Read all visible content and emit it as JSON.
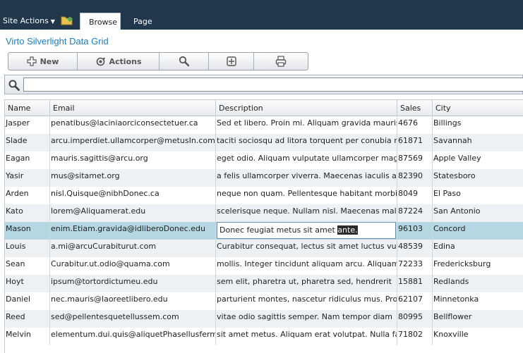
{
  "ribbon": {
    "site_actions": "Site Actions",
    "tabs": [
      {
        "label": "Browse"
      },
      {
        "label": "Page"
      }
    ]
  },
  "page": {
    "title": "Virto Silverlight Data Grid"
  },
  "toolbar": {
    "new_label": "New",
    "actions_label": "Actions"
  },
  "search": {
    "value": "",
    "placeholder": ""
  },
  "grid": {
    "columns": [
      "Name",
      "Email",
      "Description",
      "Sales",
      "City"
    ],
    "rows": [
      {
        "name": "Jasper",
        "email": "penatibus@laciniaorciconsectetuer.ca",
        "description": "Sed et libero. Proin mi. Aliquam gravida mauris",
        "sales": "4676",
        "city": "Billings"
      },
      {
        "name": "Slade",
        "email": "arcu.imperdiet.ullamcorper@metusIn.com",
        "description": "taciti sociosqu ad litora torquent per conubia n",
        "sales": "61871",
        "city": "Savannah"
      },
      {
        "name": "Eagan",
        "email": "mauris.sagittis@arcu.org",
        "description": "eget odio. Aliquam vulputate ullamcorper magna",
        "sales": "87569",
        "city": "Apple Valley"
      },
      {
        "name": "Yasir",
        "email": "mus@sitamet.org",
        "description": "a felis ullamcorper viverra. Maecenas iaculis a",
        "sales": "82390",
        "city": "Statesboro"
      },
      {
        "name": "Arden",
        "email": "nisl.Quisque@nibhDonec.ca",
        "description": "neque non quam. Pellentesque habitant morbi",
        "sales": "8049",
        "city": "El Paso"
      },
      {
        "name": "Kato",
        "email": "lorem@Aliquamerat.edu",
        "description": "scelerisque neque. Nullam nisl. Maecenas male",
        "sales": "87224",
        "city": "San Antonio"
      },
      {
        "name": "Mason",
        "email": "enim.Etiam.gravida@idliberoDonec.edu",
        "description": "",
        "sales": "96103",
        "city": "Concord",
        "editing": true,
        "editor_text": "Donec feugiat metus sit amet ",
        "editor_selected": "ante."
      },
      {
        "name": "Louis",
        "email": "a.mi@arcuCurabiturut.com",
        "description": "Curabitur consequat, lectus sit amet luctus vu",
        "sales": "48539",
        "city": "Edina"
      },
      {
        "name": "Sean",
        "email": "Curabitur.ut.odio@quama.com",
        "description": "mollis. Integer tincidunt aliquam arcu. Aliquam",
        "sales": "72233",
        "city": "Fredericksburg"
      },
      {
        "name": "Hoyt",
        "email": "ipsum@tortordictumeu.edu",
        "description": "sem elit, pharetra ut, pharetra sed, hendrerit",
        "sales": "15881",
        "city": "Redlands"
      },
      {
        "name": "Daniel",
        "email": "nec.mauris@laoreetlibero.edu",
        "description": "parturient montes, nascetur ridiculus mus. Pro",
        "sales": "62107",
        "city": "Minnetonka"
      },
      {
        "name": "Reed",
        "email": "sed@pellentesquetellussem.com",
        "description": "vitae odio sagittis semper. Nam tempor diam",
        "sales": "80995",
        "city": "Bellflower"
      },
      {
        "name": "Melvin",
        "email": "elementum.dui.quis@aliquetPhasellusferm",
        "description": "sit amet metus. Aliquam erat volutpat. Nulla fa",
        "sales": "71802",
        "city": "Knoxville"
      }
    ]
  }
}
